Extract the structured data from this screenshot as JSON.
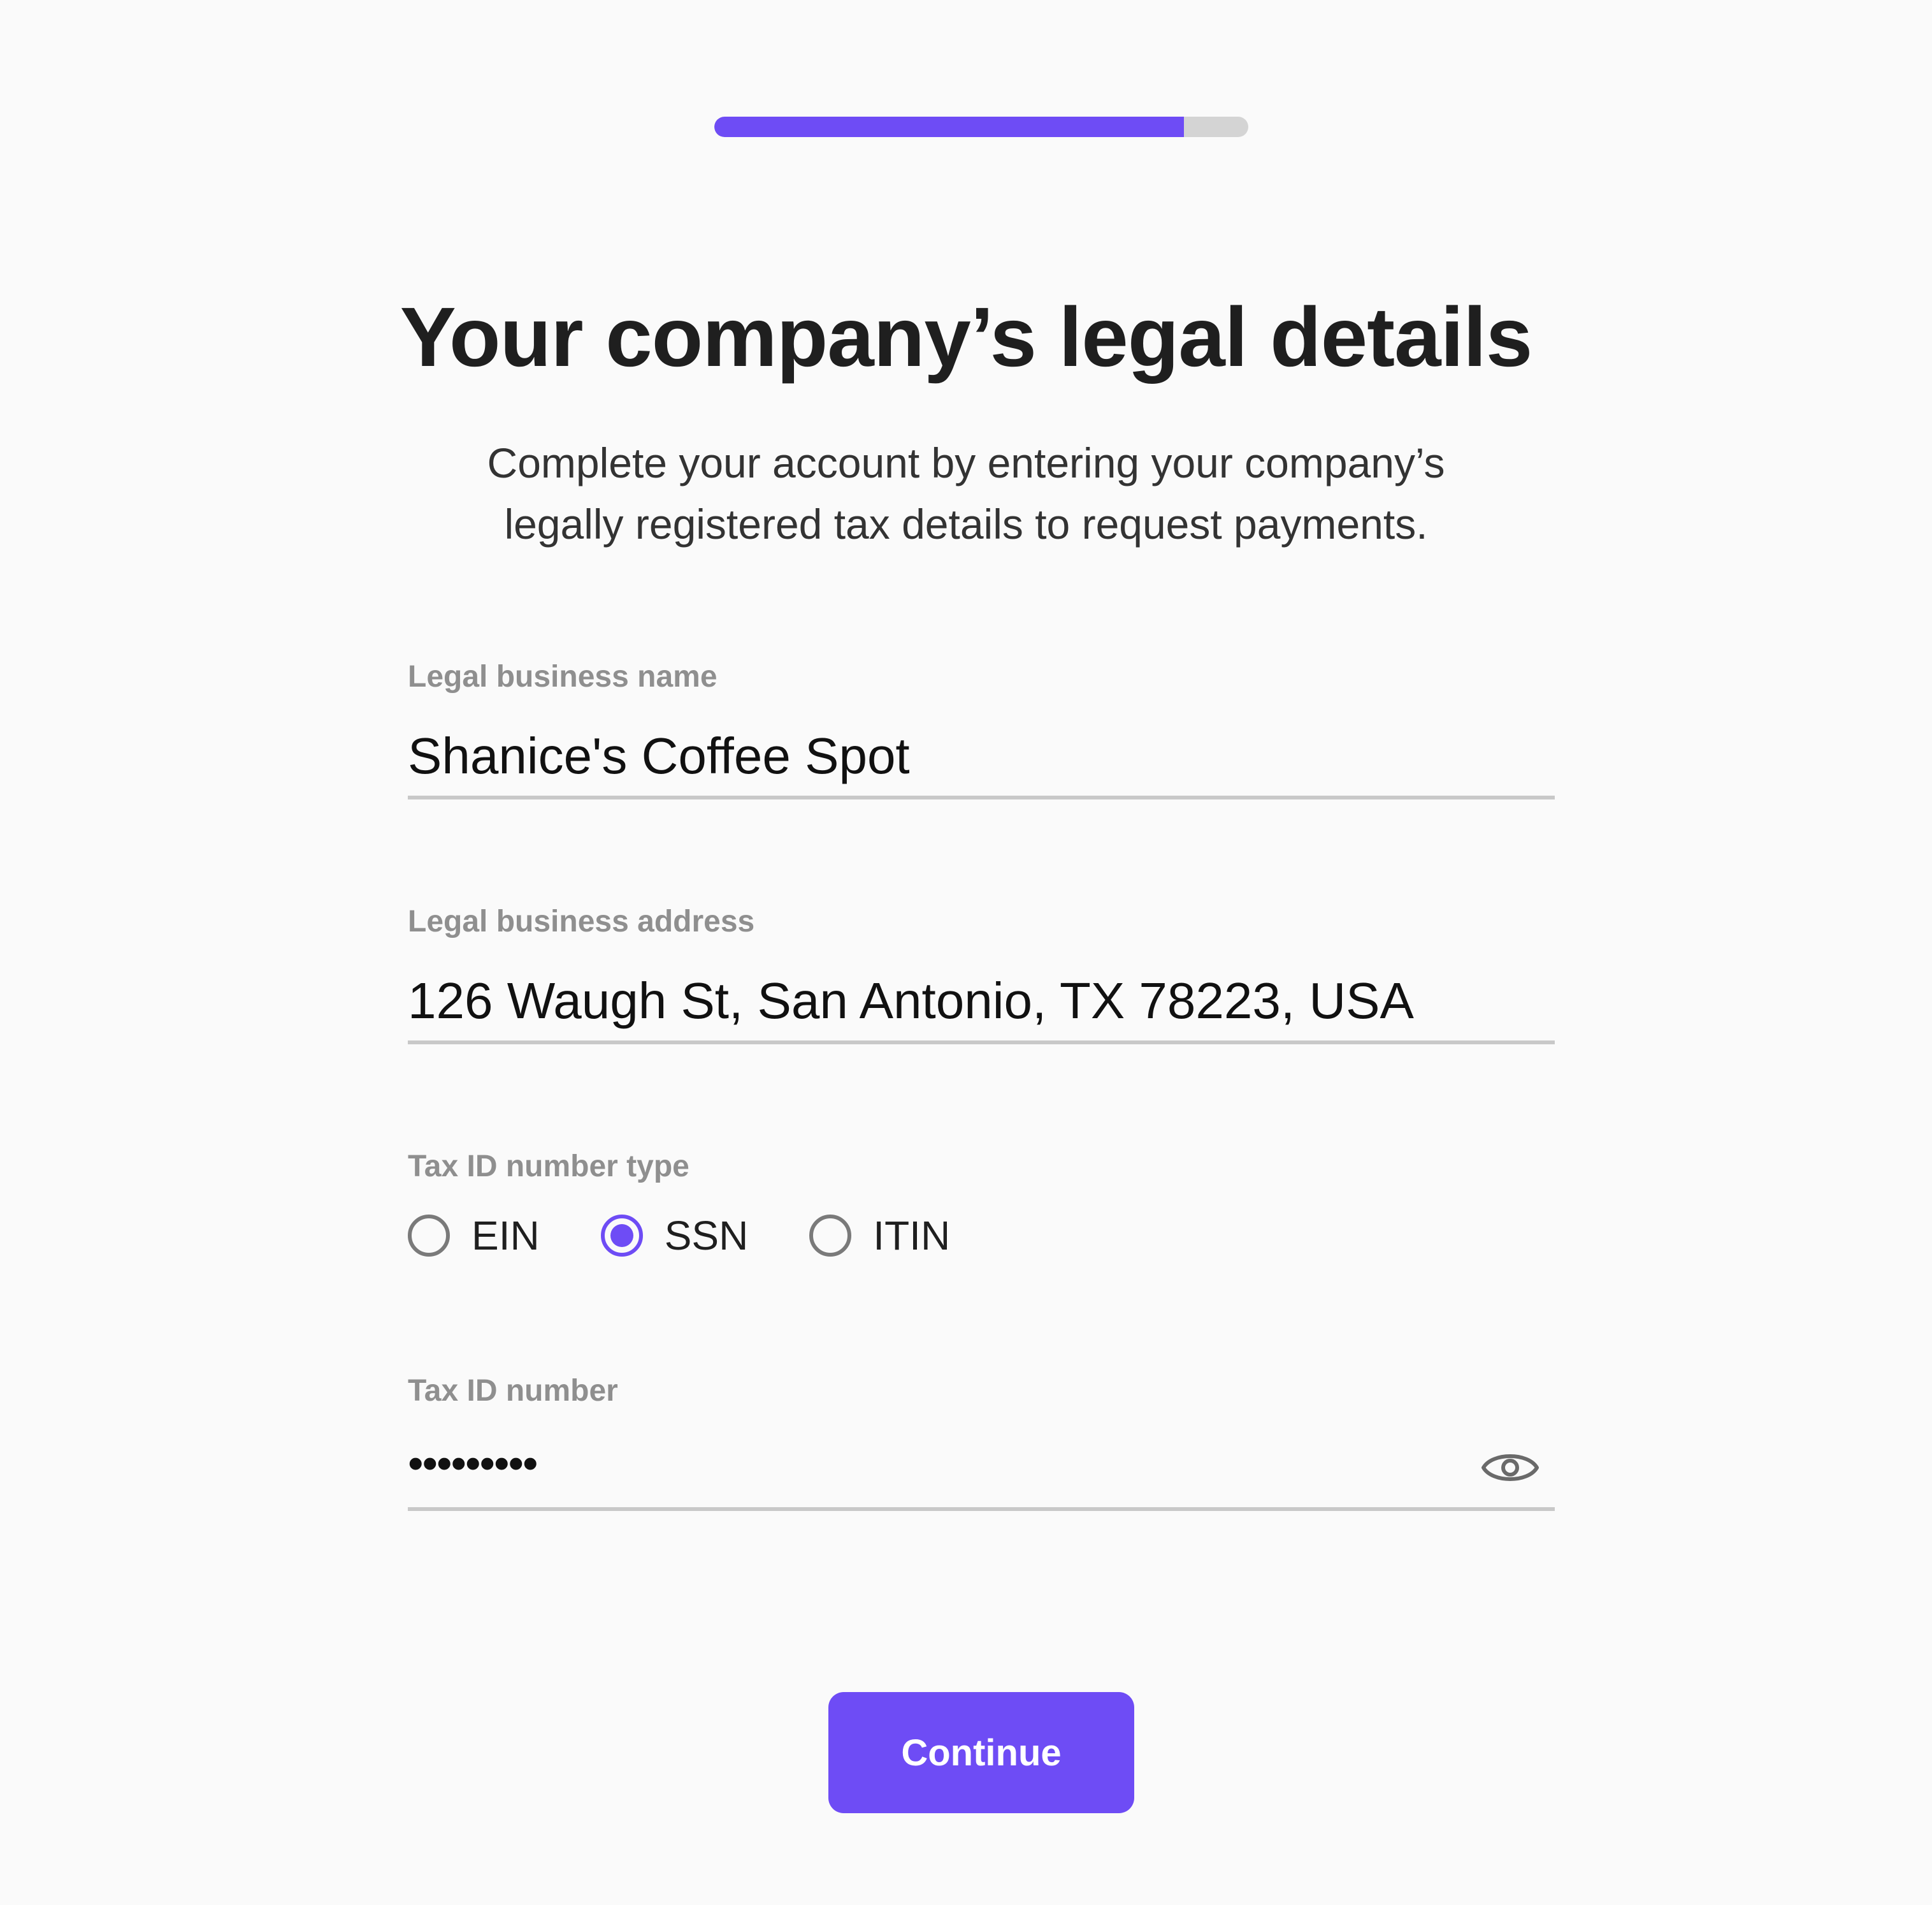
{
  "progress": {
    "fraction": 0.88
  },
  "header": {
    "title": "Your company’s legal details",
    "subtitle_line1": "Complete your account by entering your company’s",
    "subtitle_line2": "legally registered tax details to request payments."
  },
  "fields": {
    "business_name": {
      "label": "Legal business name",
      "value": "Shanice's Coffee Spot"
    },
    "business_address": {
      "label": "Legal business address",
      "value": "126 Waugh St, San Antonio, TX 78223, USA"
    },
    "tax_id_type": {
      "label": "Tax ID number type",
      "options": [
        "EIN",
        "SSN",
        "ITIN"
      ],
      "selected": "SSN"
    },
    "tax_id_number": {
      "label": "Tax ID number",
      "masked_value": "•••••••••"
    }
  },
  "actions": {
    "continue_label": "Continue"
  },
  "colors": {
    "accent": "#6e4cf5",
    "track": "#d4d4d4",
    "label": "#8f8f8f"
  },
  "icons": {
    "reveal": "eye-icon"
  }
}
